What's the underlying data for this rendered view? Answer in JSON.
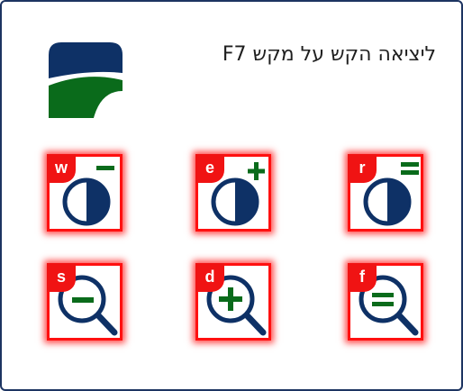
{
  "header": {
    "hint_text": "ליציאה הקש על מקש F7",
    "logo_icon": "ministry-logo"
  },
  "colors": {
    "navy": "#0e3166",
    "green": "#0a6b1b",
    "red": "#ff1010"
  },
  "toolbar": {
    "contrast_tools": [
      {
        "key": "w",
        "icon": "contrast-decrease-icon"
      },
      {
        "key": "e",
        "icon": "contrast-increase-icon"
      },
      {
        "key": "r",
        "icon": "contrast-reset-icon"
      }
    ],
    "zoom_tools": [
      {
        "key": "s",
        "icon": "zoom-out-icon"
      },
      {
        "key": "d",
        "icon": "zoom-in-icon"
      },
      {
        "key": "f",
        "icon": "zoom-reset-icon"
      }
    ]
  }
}
